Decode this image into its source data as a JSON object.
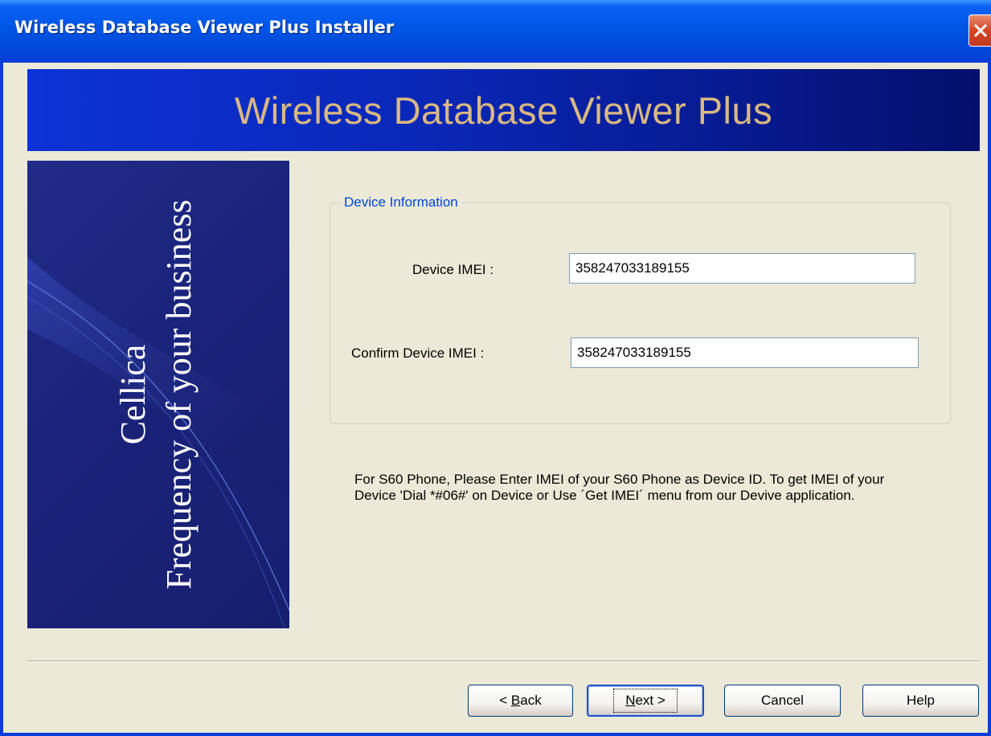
{
  "window": {
    "title": "Wireless Database Viewer Plus Installer"
  },
  "banner": {
    "title": "Wireless Database Viewer Plus"
  },
  "side_panel": {
    "line1": "Cellica",
    "line2": "Frequency of your business"
  },
  "device_info": {
    "legend": "Device Information",
    "imei_label": "Device IMEI :",
    "imei_value": "358247033189155",
    "confirm_label": "Confirm Device IMEI :",
    "confirm_value": "358247033189155"
  },
  "hint": {
    "text": "For S60 Phone, Please Enter IMEI of your S60 Phone as Device ID. To get IMEI of your Device 'Dial *#06#' on Device or Use ´Get IMEI´ menu from our Devive application."
  },
  "buttons": {
    "back": {
      "prefix": "< ",
      "mnemonic": "B",
      "rest": "ack"
    },
    "next": {
      "mnemonic": "N",
      "rest": "ext >"
    },
    "cancel": "Cancel",
    "help": "Help"
  },
  "colors": {
    "titlebar": "#0055e5",
    "banner_text": "#d9b883",
    "legend_text": "#0046d5"
  }
}
